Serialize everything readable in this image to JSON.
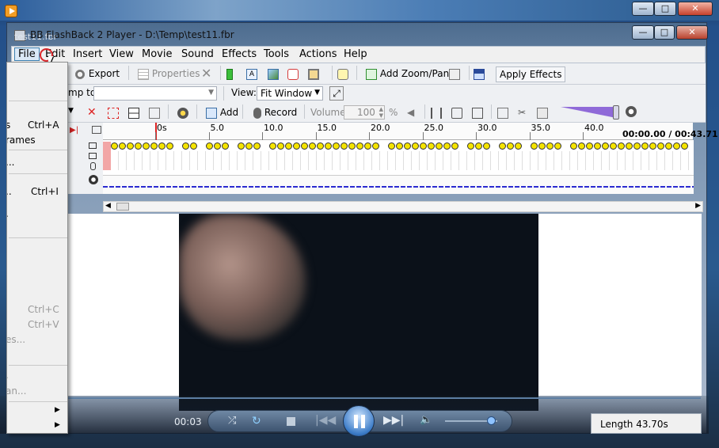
{
  "outer_window": {
    "title": "test11.fbr",
    "length_label": "Length 43.70s",
    "elapsed": "00:03"
  },
  "window": {
    "title": "BB FlashBack 2 Player - D:\\Temp\\test11.fbr"
  },
  "menubar": [
    "File",
    "Edit",
    "Insert",
    "View",
    "Movie",
    "Sound",
    "Effects",
    "Tools",
    "Actions",
    "Help"
  ],
  "toolbar1": {
    "export": "Export",
    "properties": "Properties",
    "add_zoom_pan": "Add Zoom/Pan",
    "apply_effects": "Apply Effects"
  },
  "toolbar2": {
    "jump_to": "mp to:",
    "view_label": "View:",
    "view_value": "Fit Window"
  },
  "toolbar3": {
    "add": "Add",
    "record": "Record",
    "volume_label": "Volume:",
    "volume_value": "100",
    "percent": "%"
  },
  "timeline": {
    "ticks": [
      "0s",
      "5.0",
      "10.0",
      "15.0",
      "20.0",
      "25.0",
      "30.0",
      "35.0",
      "40.0"
    ],
    "time": "00:00.00 / 00:43.71"
  },
  "file_menu": {
    "items": [
      {
        "label": "s",
        "shortcut": "Ctrl+A",
        "disabled": false
      },
      {
        "label": "rames",
        "shortcut": "",
        "disabled": false
      },
      {
        "label": "...",
        "shortcut": "",
        "disabled": false
      },
      {
        "label": "..",
        "shortcut": "Ctrl+I",
        "disabled": false
      },
      {
        "label": ".",
        "shortcut": "",
        "disabled": false
      },
      {
        "label": "",
        "shortcut": "Ctrl+C",
        "disabled": true
      },
      {
        "label": "",
        "shortcut": "Ctrl+V",
        "disabled": true
      },
      {
        "label": "es...",
        "shortcut": "",
        "disabled": true
      },
      {
        "label": ".",
        "shortcut": "",
        "disabled": true
      },
      {
        "label": "an...",
        "shortcut": "",
        "disabled": true
      }
    ]
  },
  "colors": {
    "accent": "#3a6ea5",
    "marker_yellow": "#f5e400",
    "audio_line": "#2a2ad0"
  }
}
